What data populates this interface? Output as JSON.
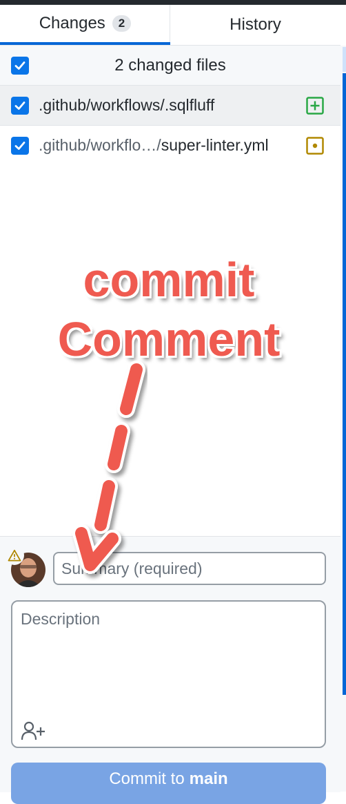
{
  "tabs": [
    {
      "label": "Changes",
      "count": "2",
      "active": true
    },
    {
      "label": "History",
      "active": false
    }
  ],
  "changes_header": {
    "label": "2 changed files",
    "checked": true
  },
  "files": [
    {
      "dir": ".github/workflows/",
      "name": ".sqlfluff",
      "status": "added",
      "checked": true,
      "selected": true
    },
    {
      "dir": ".github/workflo…/",
      "name": "super-linter.yml",
      "status": "modified",
      "checked": true,
      "selected": false
    }
  ],
  "annotation": {
    "line1": "commit",
    "line2": "Comment"
  },
  "commit": {
    "summary_placeholder": "Summary (required)",
    "description_placeholder": "Description",
    "button_prefix": "Commit to",
    "branch": "main"
  },
  "colors": {
    "accent": "#0366d6",
    "added": "#28a745",
    "modified": "#b08800",
    "annotation": "#ef5a50",
    "button": "#79a4e4"
  },
  "icons": [
    "checkbox-checked-icon",
    "file-added-icon",
    "file-modified-icon",
    "warning-icon",
    "avatar",
    "add-coauthor-icon",
    "arrow-icon"
  ]
}
